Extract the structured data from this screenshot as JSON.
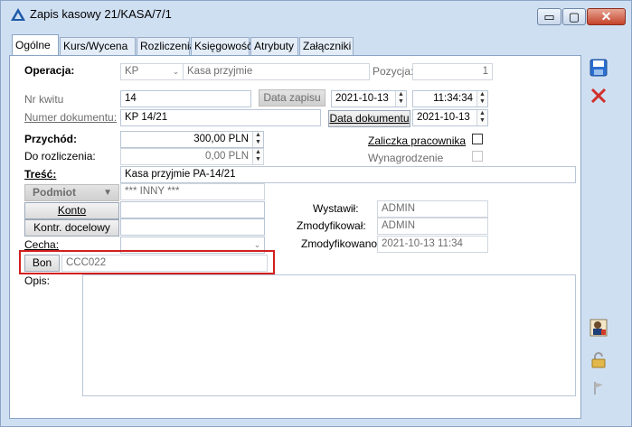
{
  "window": {
    "title": "Zapis kasowy 21/KASA/7/1",
    "minimize_glyph": "▭",
    "maximize_glyph": "▢",
    "close_glyph": "✕"
  },
  "tabs": [
    {
      "label": "Ogólne"
    },
    {
      "label": "Kurs/Wycena"
    },
    {
      "label": "Rozliczenia"
    },
    {
      "label": "Księgowość"
    },
    {
      "label": "Atrybuty"
    },
    {
      "label": "Załączniki"
    }
  ],
  "form": {
    "operacja_label": "Operacja:",
    "operacja_code": "KP",
    "operacja_name": "Kasa przyjmie",
    "pozycja_label": "Pozycja:",
    "pozycja_value": "1",
    "nr_kwitu_label": "Nr kwitu",
    "nr_kwitu_value": "14",
    "data_zapisu_label": "Data zapisu",
    "data_zapisu_value": "2021-10-13",
    "time_value": "11:34:34",
    "numer_dokumentu_label": "Numer dokumentu:",
    "numer_dokumentu_value": "KP 14/21",
    "data_dokumentu_label": "Data dokumentu",
    "data_dokumentu_value": "2021-10-13",
    "przychod_label": "Przychód:",
    "przychod_value": "300,00 PLN",
    "do_rozliczenia_label": "Do rozliczenia:",
    "do_rozliczenia_value": "0,00 PLN",
    "zaliczka_label": "Zaliczka pracownika",
    "wynagrodzenie_label": "Wynagrodzenie",
    "tresc_label": "Treść:",
    "tresc_value": "Kasa przyjmie PA-14/21",
    "podmiot_label": "Podmiot",
    "podmiot_value": "*** INNY ***",
    "konto_label": "Konto",
    "kontr_docelowy_label": "Kontr. docelowy",
    "cecha_label": "Cecha:",
    "bon_label": "Bon",
    "bon_value": "CCC022",
    "opis_label": "Opis:",
    "wystawil_label": "Wystawił:",
    "wystawil_value": "ADMIN",
    "zmodyfikowal_label": "Zmodyfikował:",
    "zmodyfikowal_value": "ADMIN",
    "zmodyfikowano_label": "Zmodyfikowano:",
    "zmodyfikowano_value": "2021-10-13 11:34"
  },
  "colors": {
    "accent": "#1e5aa8",
    "close_red": "#d0302a",
    "highlight_box": "#d21f1f"
  }
}
